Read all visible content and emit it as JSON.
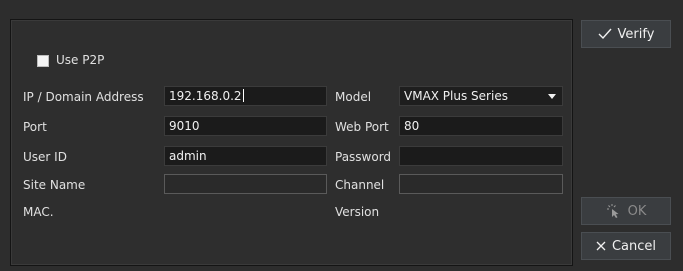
{
  "buttons": {
    "verify": "Verify",
    "ok": "OK",
    "cancel": "Cancel"
  },
  "form": {
    "use_p2p": {
      "label": "Use P2P",
      "checked": false
    },
    "ip": {
      "label": "IP / Domain Address",
      "value": "192.168.0.2"
    },
    "model": {
      "label": "Model",
      "value": "VMAX Plus Series"
    },
    "port": {
      "label": "Port",
      "value": "9010"
    },
    "web_port": {
      "label": "Web Port",
      "value": "80"
    },
    "user_id": {
      "label": "User ID",
      "value": "admin"
    },
    "password": {
      "label": "Password",
      "value": ""
    },
    "site_name": {
      "label": "Site Name",
      "value": ""
    },
    "channel": {
      "label": "Channel",
      "value": ""
    },
    "mac": {
      "label": "MAC."
    },
    "version": {
      "label": "Version"
    }
  },
  "icons": {
    "verify": "checkmark-icon",
    "ok": "pointer-click-icon",
    "cancel": "close-icon",
    "model_dropdown": "caret-down-icon"
  }
}
